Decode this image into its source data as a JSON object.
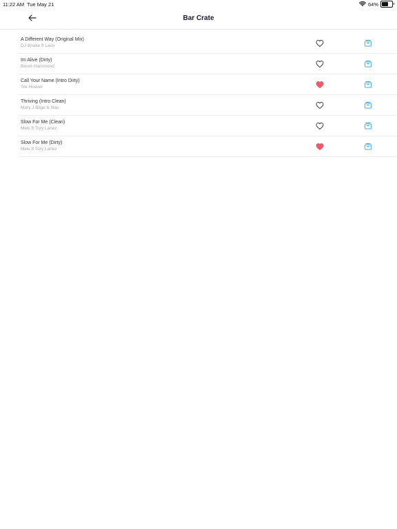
{
  "status_bar": {
    "time": "11:22 AM",
    "date": "Tue May 21",
    "battery_percent": "64%",
    "battery_level": 0.64
  },
  "header": {
    "title": "Bar Crate",
    "back_icon": "arrow-left-icon"
  },
  "colors": {
    "liked": "#f25a6c",
    "unliked_stroke": "#333333",
    "crate_icon": "#4aa3df"
  },
  "tracks": [
    {
      "title": "A Different Way  (Original Mix)",
      "artist": "DJ Snake ft Lauv",
      "liked": false
    },
    {
      "title": "Im Alive  (Dirty)",
      "artist": "Beres Hammond",
      "liked": false
    },
    {
      "title": "Call Your Name  (Intro Dirty)",
      "artist": "Tre Hoover",
      "liked": true
    },
    {
      "title": "Thriving  (Intro Clean)",
      "artist": "Mary J Blige & Nas",
      "liked": false
    },
    {
      "title": "Slow For Me  (Clean)",
      "artist": "Meki ft Tory Lanez",
      "liked": false
    },
    {
      "title": "Slow For Me  (Dirty)",
      "artist": "Meki ft Tory Lanez",
      "liked": true
    }
  ]
}
